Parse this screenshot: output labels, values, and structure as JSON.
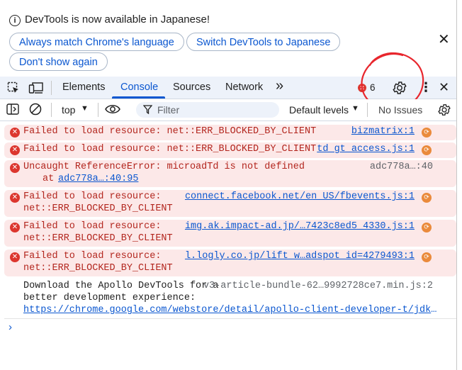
{
  "infobar": {
    "message": "DevTools is now available in Japanese!",
    "btn_match": "Always match Chrome's language",
    "btn_switch": "Switch DevTools to Japanese",
    "btn_dont_show": "Don't show again",
    "close": "✕"
  },
  "tabs": {
    "elements": "Elements",
    "console": "Console",
    "sources": "Sources",
    "network": "Network",
    "more": "»",
    "error_count": "6",
    "menu": "⋮",
    "close": "✕"
  },
  "toolbar": {
    "context": "top",
    "filter_placeholder": "Filter",
    "levels": "Default levels",
    "issues": "No Issues"
  },
  "messages": [
    {
      "type": "error",
      "line1": "Failed to load resource: net::ERR_BLOCKED_BY_CLIENT",
      "source": "bizmatrix:1"
    },
    {
      "type": "error",
      "line1": "Failed to load resource: net::ERR_BLOCKED_BY_CLIENT",
      "source": "td_gt_access.js:1"
    },
    {
      "type": "error",
      "line1": "Uncaught ReferenceError: microadTd is not defined",
      "line2": "at ",
      "line2_link": "adc778a…:40:95",
      "source": "adc778a…:40"
    },
    {
      "type": "error",
      "line1": "Failed to load resource:",
      "line2": "net::ERR_BLOCKED_BY_CLIENT",
      "source": "connect.facebook.net/en_US/fbevents.js:1"
    },
    {
      "type": "error",
      "line1": "Failed to load resource:",
      "line2": "net::ERR_BLOCKED_BY_CLIENT",
      "source": "img.ak.impact-ad.jp/…7423c8ed5_4330.js:1"
    },
    {
      "type": "error",
      "line1": "Failed to load resource:",
      "line2": "net::ERR_BLOCKED_BY_CLIENT",
      "source": "l.logly.co.jp/lift_w…adspot_id=4279493:1"
    },
    {
      "type": "log",
      "line1": "Download the Apollo DevTools for a",
      "line2": "better development experience:",
      "link": "https://chrome.google.com/webstore/detail/apollo-client-developer-t/jdkknkkbebbap…",
      "source": "v3-article-bundle-62…9992728ce7.min.js:2"
    }
  ],
  "prompt": "›",
  "colors": {
    "accent": "#0b57d0",
    "error_bg": "#fce8e8",
    "error_text": "#b3261e",
    "annotation": "#e8262d"
  }
}
